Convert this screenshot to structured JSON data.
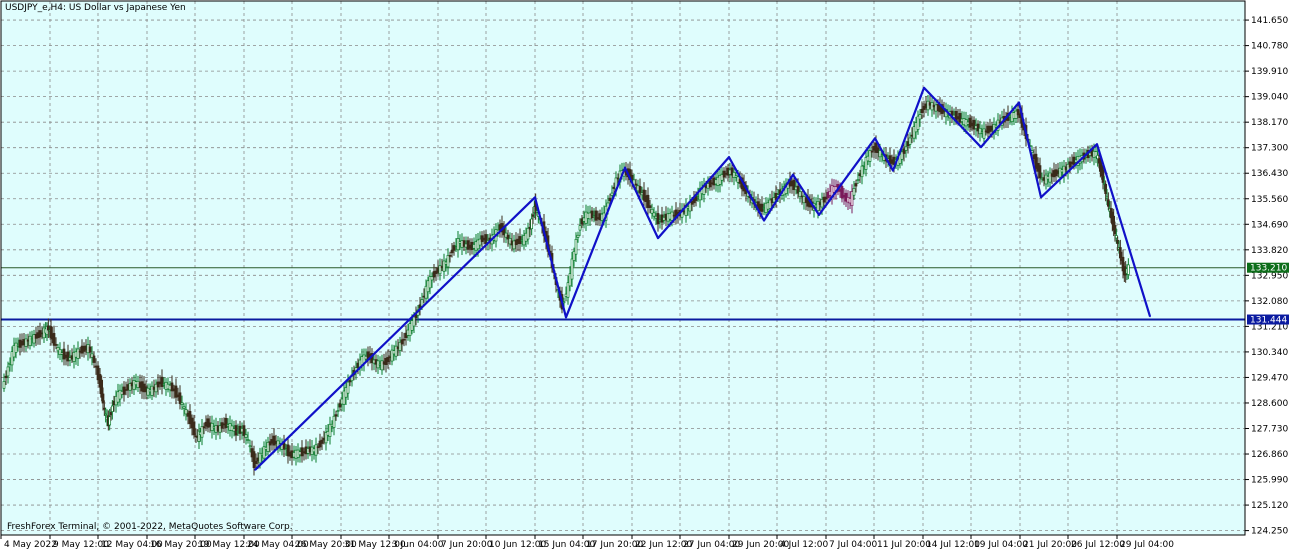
{
  "window": {
    "symbol_title": "USDJPY_e,H4:  US Dollar vs Japanese Yen",
    "copyright": "FreshForex Terminal, © 2001-2022, MetaQuotes Software Corp."
  },
  "colors": {
    "background": "#dffdfd",
    "grid": "#8a8a8a",
    "zigzag": "#1010c8",
    "hline": "#0a1aa0",
    "bid_line": "#2a5a2a",
    "bid_badge": "#0d6e1a",
    "level_badge": "#0a1aa0",
    "candle_up": "#0a7a2a",
    "candle_down": "#3a2a1a",
    "candle_purple": "#7a1a5a"
  },
  "chart_data": {
    "type": "line",
    "title": "USDJPY_e,H4:  US Dollar vs Japanese Yen",
    "ylim": [
      124.1,
      142.3
    ],
    "x_range": [
      0,
      1244
    ],
    "y_ticks": [
      "141.650",
      "140.780",
      "139.910",
      "139.040",
      "138.170",
      "137.300",
      "136.430",
      "135.560",
      "134.690",
      "133.820",
      "132.950",
      "132.080",
      "131.210",
      "130.340",
      "129.470",
      "128.600",
      "127.730",
      "126.860",
      "125.990",
      "125.120",
      "124.250"
    ],
    "x_ticks": [
      {
        "label": "4 May 2022",
        "x": 0
      },
      {
        "label": "9 May 12:00",
        "x": 49
      },
      {
        "label": "12 May 04:00",
        "x": 97
      },
      {
        "label": "16 May 20:00",
        "x": 146
      },
      {
        "label": "19 May 12:00",
        "x": 194
      },
      {
        "label": "24 May 04:00",
        "x": 243
      },
      {
        "label": "26 May 20:00",
        "x": 291
      },
      {
        "label": "31 May 12:00",
        "x": 340
      },
      {
        "label": "3 Jun 04:00",
        "x": 388
      },
      {
        "label": "7 Jun 20:00",
        "x": 437
      },
      {
        "label": "10 Jun 12:00",
        "x": 485
      },
      {
        "label": "15 Jun 04:00",
        "x": 534
      },
      {
        "label": "17 Jun 20:00",
        "x": 582
      },
      {
        "label": "22 Jun 12:00",
        "x": 631
      },
      {
        "label": "27 Jun 04:00",
        "x": 679
      },
      {
        "label": "29 Jun 20:00",
        "x": 728
      },
      {
        "label": "4 Jul 12:00",
        "x": 776
      },
      {
        "label": "7 Jul 04:00",
        "x": 825
      },
      {
        "label": "11 Jul 20:00",
        "x": 873
      },
      {
        "label": "14 Jul 12:00",
        "x": 922
      },
      {
        "label": "19 Jul 04:00",
        "x": 970
      },
      {
        "label": "21 Jul 20:00",
        "x": 1019
      },
      {
        "label": "26 Jul 12:00",
        "x": 1067
      },
      {
        "label": "29 Jul 04:00",
        "x": 1116
      }
    ],
    "grid": true,
    "horizontal_levels": [
      {
        "name": "bid",
        "value": 133.21,
        "label": "133.210"
      },
      {
        "name": "level",
        "value": 131.444,
        "label": "131.444"
      }
    ],
    "zigzag": [
      {
        "x": 254,
        "y": 126.32
      },
      {
        "x": 534,
        "y": 135.61
      },
      {
        "x": 565,
        "y": 131.52
      },
      {
        "x": 624,
        "y": 136.62
      },
      {
        "x": 657,
        "y": 134.22
      },
      {
        "x": 728,
        "y": 136.98
      },
      {
        "x": 763,
        "y": 134.82
      },
      {
        "x": 792,
        "y": 136.38
      },
      {
        "x": 818,
        "y": 135.01
      },
      {
        "x": 874,
        "y": 137.62
      },
      {
        "x": 892,
        "y": 136.52
      },
      {
        "x": 923,
        "y": 139.34
      },
      {
        "x": 980,
        "y": 137.32
      },
      {
        "x": 1018,
        "y": 138.84
      },
      {
        "x": 1040,
        "y": 135.61
      },
      {
        "x": 1096,
        "y": 137.42
      },
      {
        "x": 1149,
        "y": 131.55
      }
    ],
    "price_path": [
      {
        "x": 2,
        "y": 129.1
      },
      {
        "x": 8,
        "y": 129.8
      },
      {
        "x": 14,
        "y": 130.5
      },
      {
        "x": 20,
        "y": 130.6
      },
      {
        "x": 26,
        "y": 130.7
      },
      {
        "x": 32,
        "y": 130.8
      },
      {
        "x": 38,
        "y": 130.9
      },
      {
        "x": 44,
        "y": 131.05
      },
      {
        "x": 48,
        "y": 131.15
      },
      {
        "x": 52,
        "y": 130.8
      },
      {
        "x": 58,
        "y": 130.4
      },
      {
        "x": 64,
        "y": 130.2
      },
      {
        "x": 70,
        "y": 130.1
      },
      {
        "x": 76,
        "y": 130.3
      },
      {
        "x": 82,
        "y": 130.4
      },
      {
        "x": 88,
        "y": 130.5
      },
      {
        "x": 94,
        "y": 130.0
      },
      {
        "x": 100,
        "y": 129.2
      },
      {
        "x": 104,
        "y": 128.3
      },
      {
        "x": 108,
        "y": 127.9
      },
      {
        "x": 112,
        "y": 128.5
      },
      {
        "x": 118,
        "y": 128.9
      },
      {
        "x": 124,
        "y": 129.0
      },
      {
        "x": 130,
        "y": 129.2
      },
      {
        "x": 136,
        "y": 129.3
      },
      {
        "x": 142,
        "y": 129.1
      },
      {
        "x": 148,
        "y": 129.0
      },
      {
        "x": 154,
        "y": 129.1
      },
      {
        "x": 160,
        "y": 129.3
      },
      {
        "x": 166,
        "y": 129.2
      },
      {
        "x": 172,
        "y": 129.1
      },
      {
        "x": 178,
        "y": 128.8
      },
      {
        "x": 184,
        "y": 128.4
      },
      {
        "x": 190,
        "y": 128.0
      },
      {
        "x": 196,
        "y": 127.4
      },
      {
        "x": 200,
        "y": 127.6
      },
      {
        "x": 206,
        "y": 127.9
      },
      {
        "x": 212,
        "y": 127.8
      },
      {
        "x": 218,
        "y": 127.7
      },
      {
        "x": 224,
        "y": 127.9
      },
      {
        "x": 230,
        "y": 127.8
      },
      {
        "x": 236,
        "y": 127.6
      },
      {
        "x": 242,
        "y": 127.7
      },
      {
        "x": 248,
        "y": 127.3
      },
      {
        "x": 254,
        "y": 126.5
      },
      {
        "x": 260,
        "y": 126.8
      },
      {
        "x": 266,
        "y": 127.1
      },
      {
        "x": 272,
        "y": 127.3
      },
      {
        "x": 278,
        "y": 127.2
      },
      {
        "x": 284,
        "y": 127.1
      },
      {
        "x": 290,
        "y": 126.8
      },
      {
        "x": 296,
        "y": 126.9
      },
      {
        "x": 302,
        "y": 126.9
      },
      {
        "x": 308,
        "y": 127.0
      },
      {
        "x": 314,
        "y": 127.0
      },
      {
        "x": 320,
        "y": 127.2
      },
      {
        "x": 326,
        "y": 127.5
      },
      {
        "x": 332,
        "y": 127.9
      },
      {
        "x": 338,
        "y": 128.4
      },
      {
        "x": 344,
        "y": 128.9
      },
      {
        "x": 350,
        "y": 129.4
      },
      {
        "x": 356,
        "y": 129.8
      },
      {
        "x": 362,
        "y": 130.1
      },
      {
        "x": 368,
        "y": 130.2
      },
      {
        "x": 374,
        "y": 130.0
      },
      {
        "x": 380,
        "y": 129.9
      },
      {
        "x": 386,
        "y": 130.0
      },
      {
        "x": 392,
        "y": 130.3
      },
      {
        "x": 398,
        "y": 130.5
      },
      {
        "x": 404,
        "y": 130.8
      },
      {
        "x": 410,
        "y": 131.2
      },
      {
        "x": 416,
        "y": 131.6
      },
      {
        "x": 422,
        "y": 132.1
      },
      {
        "x": 428,
        "y": 132.7
      },
      {
        "x": 434,
        "y": 133.0
      },
      {
        "x": 440,
        "y": 133.2
      },
      {
        "x": 446,
        "y": 133.4
      },
      {
        "x": 452,
        "y": 133.8
      },
      {
        "x": 458,
        "y": 134.1
      },
      {
        "x": 464,
        "y": 134.0
      },
      {
        "x": 470,
        "y": 133.9
      },
      {
        "x": 476,
        "y": 134.0
      },
      {
        "x": 482,
        "y": 134.2
      },
      {
        "x": 488,
        "y": 134.1
      },
      {
        "x": 494,
        "y": 134.3
      },
      {
        "x": 500,
        "y": 134.6
      },
      {
        "x": 506,
        "y": 134.3
      },
      {
        "x": 512,
        "y": 134.0
      },
      {
        "x": 518,
        "y": 134.1
      },
      {
        "x": 524,
        "y": 134.2
      },
      {
        "x": 530,
        "y": 134.6
      },
      {
        "x": 534,
        "y": 135.3
      },
      {
        "x": 538,
        "y": 135.0
      },
      {
        "x": 544,
        "y": 134.4
      },
      {
        "x": 550,
        "y": 133.6
      },
      {
        "x": 556,
        "y": 132.6
      },
      {
        "x": 562,
        "y": 131.9
      },
      {
        "x": 568,
        "y": 132.6
      },
      {
        "x": 574,
        "y": 133.8
      },
      {
        "x": 580,
        "y": 134.7
      },
      {
        "x": 586,
        "y": 135.0
      },
      {
        "x": 592,
        "y": 135.0
      },
      {
        "x": 598,
        "y": 134.9
      },
      {
        "x": 604,
        "y": 135.0
      },
      {
        "x": 610,
        "y": 135.6
      },
      {
        "x": 616,
        "y": 136.2
      },
      {
        "x": 622,
        "y": 136.5
      },
      {
        "x": 628,
        "y": 136.4
      },
      {
        "x": 634,
        "y": 136.1
      },
      {
        "x": 640,
        "y": 135.8
      },
      {
        "x": 646,
        "y": 135.5
      },
      {
        "x": 652,
        "y": 135.1
      },
      {
        "x": 658,
        "y": 134.8
      },
      {
        "x": 664,
        "y": 134.9
      },
      {
        "x": 670,
        "y": 135.0
      },
      {
        "x": 676,
        "y": 135.0
      },
      {
        "x": 682,
        "y": 135.1
      },
      {
        "x": 688,
        "y": 135.3
      },
      {
        "x": 694,
        "y": 135.5
      },
      {
        "x": 700,
        "y": 135.8
      },
      {
        "x": 706,
        "y": 136.0
      },
      {
        "x": 712,
        "y": 136.1
      },
      {
        "x": 718,
        "y": 136.2
      },
      {
        "x": 724,
        "y": 136.4
      },
      {
        "x": 730,
        "y": 136.5
      },
      {
        "x": 736,
        "y": 136.3
      },
      {
        "x": 742,
        "y": 136.0
      },
      {
        "x": 748,
        "y": 135.7
      },
      {
        "x": 754,
        "y": 135.4
      },
      {
        "x": 760,
        "y": 135.2
      },
      {
        "x": 766,
        "y": 135.3
      },
      {
        "x": 772,
        "y": 135.5
      },
      {
        "x": 778,
        "y": 135.7
      },
      {
        "x": 784,
        "y": 135.9
      },
      {
        "x": 790,
        "y": 136.1
      },
      {
        "x": 796,
        "y": 135.9
      },
      {
        "x": 802,
        "y": 135.6
      },
      {
        "x": 808,
        "y": 135.4
      },
      {
        "x": 814,
        "y": 135.3
      },
      {
        "x": 820,
        "y": 135.4
      },
      {
        "x": 826,
        "y": 135.6
      },
      {
        "x": 832,
        "y": 135.9
      },
      {
        "x": 838,
        "y": 135.9
      },
      {
        "x": 844,
        "y": 135.6
      },
      {
        "x": 850,
        "y": 135.5
      },
      {
        "x": 856,
        "y": 136.1
      },
      {
        "x": 862,
        "y": 136.6
      },
      {
        "x": 868,
        "y": 137.0
      },
      {
        "x": 874,
        "y": 137.3
      },
      {
        "x": 880,
        "y": 137.1
      },
      {
        "x": 886,
        "y": 136.9
      },
      {
        "x": 892,
        "y": 136.8
      },
      {
        "x": 898,
        "y": 136.9
      },
      {
        "x": 904,
        "y": 137.2
      },
      {
        "x": 910,
        "y": 137.6
      },
      {
        "x": 916,
        "y": 138.1
      },
      {
        "x": 922,
        "y": 138.6
      },
      {
        "x": 928,
        "y": 138.8
      },
      {
        "x": 934,
        "y": 138.7
      },
      {
        "x": 940,
        "y": 138.6
      },
      {
        "x": 946,
        "y": 138.5
      },
      {
        "x": 952,
        "y": 138.4
      },
      {
        "x": 958,
        "y": 138.3
      },
      {
        "x": 964,
        "y": 138.2
      },
      {
        "x": 970,
        "y": 138.1
      },
      {
        "x": 976,
        "y": 138.0
      },
      {
        "x": 982,
        "y": 137.8
      },
      {
        "x": 988,
        "y": 137.9
      },
      {
        "x": 994,
        "y": 138.0
      },
      {
        "x": 1000,
        "y": 138.2
      },
      {
        "x": 1006,
        "y": 138.3
      },
      {
        "x": 1012,
        "y": 138.4
      },
      {
        "x": 1018,
        "y": 138.5
      },
      {
        "x": 1024,
        "y": 137.9
      },
      {
        "x": 1030,
        "y": 137.3
      },
      {
        "x": 1036,
        "y": 136.7
      },
      {
        "x": 1042,
        "y": 136.2
      },
      {
        "x": 1048,
        "y": 136.3
      },
      {
        "x": 1054,
        "y": 136.4
      },
      {
        "x": 1060,
        "y": 136.5
      },
      {
        "x": 1066,
        "y": 136.6
      },
      {
        "x": 1072,
        "y": 136.8
      },
      {
        "x": 1078,
        "y": 136.9
      },
      {
        "x": 1084,
        "y": 137.0
      },
      {
        "x": 1090,
        "y": 137.1
      },
      {
        "x": 1096,
        "y": 137.1
      },
      {
        "x": 1100,
        "y": 136.6
      },
      {
        "x": 1104,
        "y": 136.0
      },
      {
        "x": 1108,
        "y": 135.3
      },
      {
        "x": 1112,
        "y": 134.8
      },
      {
        "x": 1116,
        "y": 134.2
      },
      {
        "x": 1120,
        "y": 133.6
      },
      {
        "x": 1124,
        "y": 133.0
      },
      {
        "x": 1128,
        "y": 133.21
      }
    ]
  }
}
